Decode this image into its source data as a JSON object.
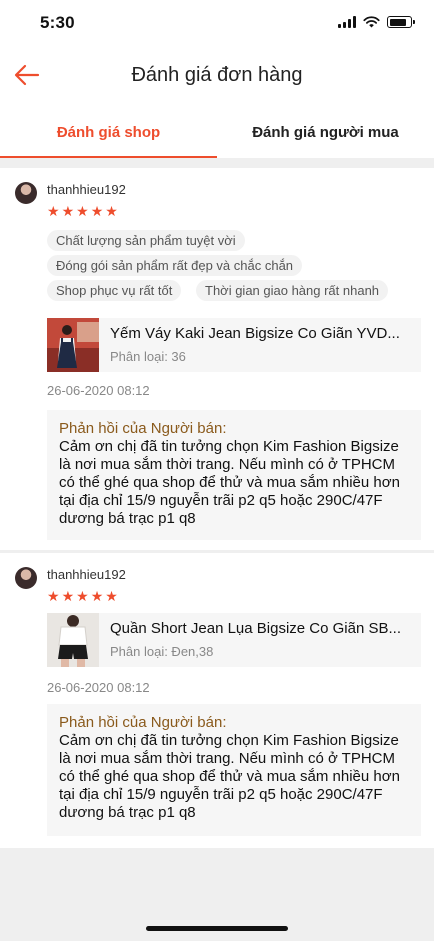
{
  "status_bar": {
    "time": "5:30"
  },
  "header": {
    "title": "Đánh giá đơn hàng"
  },
  "tabs": [
    {
      "label": "Đánh giá shop",
      "active": true
    },
    {
      "label": "Đánh giá người mua",
      "active": false
    }
  ],
  "reviews": [
    {
      "username": "thanhhieu192",
      "rating": 5,
      "tags": [
        "Chất lượng sản phẩm tuyệt vời",
        "Đóng gói sản phẩm rất đẹp và chắc chắn",
        "Shop phục vụ rất tốt",
        "Thời gian giao hàng rất nhanh"
      ],
      "product": {
        "name": "Yếm Váy Kaki Jean Bigsize Co Giãn YVD...",
        "variant": "Phân loại: 36"
      },
      "date": "26-06-2020 08:12",
      "seller_reply": {
        "title": "Phản hồi của Người bán:",
        "text": "Cảm ơn chị đã tin tưởng chọn Kim Fashion Bigsize là nơi mua sắm thời trang. Nếu mình có ở TPHCM có thể ghé qua shop để thử và mua sắm nhiều hơn tại địa chỉ 15/9 nguyễn trãi p2 q5 hoặc 290C/47F dương bá trạc p1 q8"
      }
    },
    {
      "username": "thanhhieu192",
      "rating": 5,
      "tags": [],
      "product": {
        "name": "Quần Short Jean Lụa Bigsize Co Giãn SB...",
        "variant": "Phân loại: Đen,38"
      },
      "date": "26-06-2020 08:12",
      "seller_reply": {
        "title": "Phản hồi của Người bán:",
        "text": "Cảm ơn chị đã tin tưởng chọn Kim Fashion Bigsize là nơi mua sắm thời trang. Nếu mình có ở TPHCM có thể ghé qua shop để thử và mua sắm nhiều hơn tại địa chỉ 15/9 nguyễn trãi p2 q5 hoặc 290C/47F dương bá trạc p1 q8"
      }
    }
  ],
  "colors": {
    "accent": "#ee4d2d",
    "reply_title": "#8a5a1c"
  }
}
